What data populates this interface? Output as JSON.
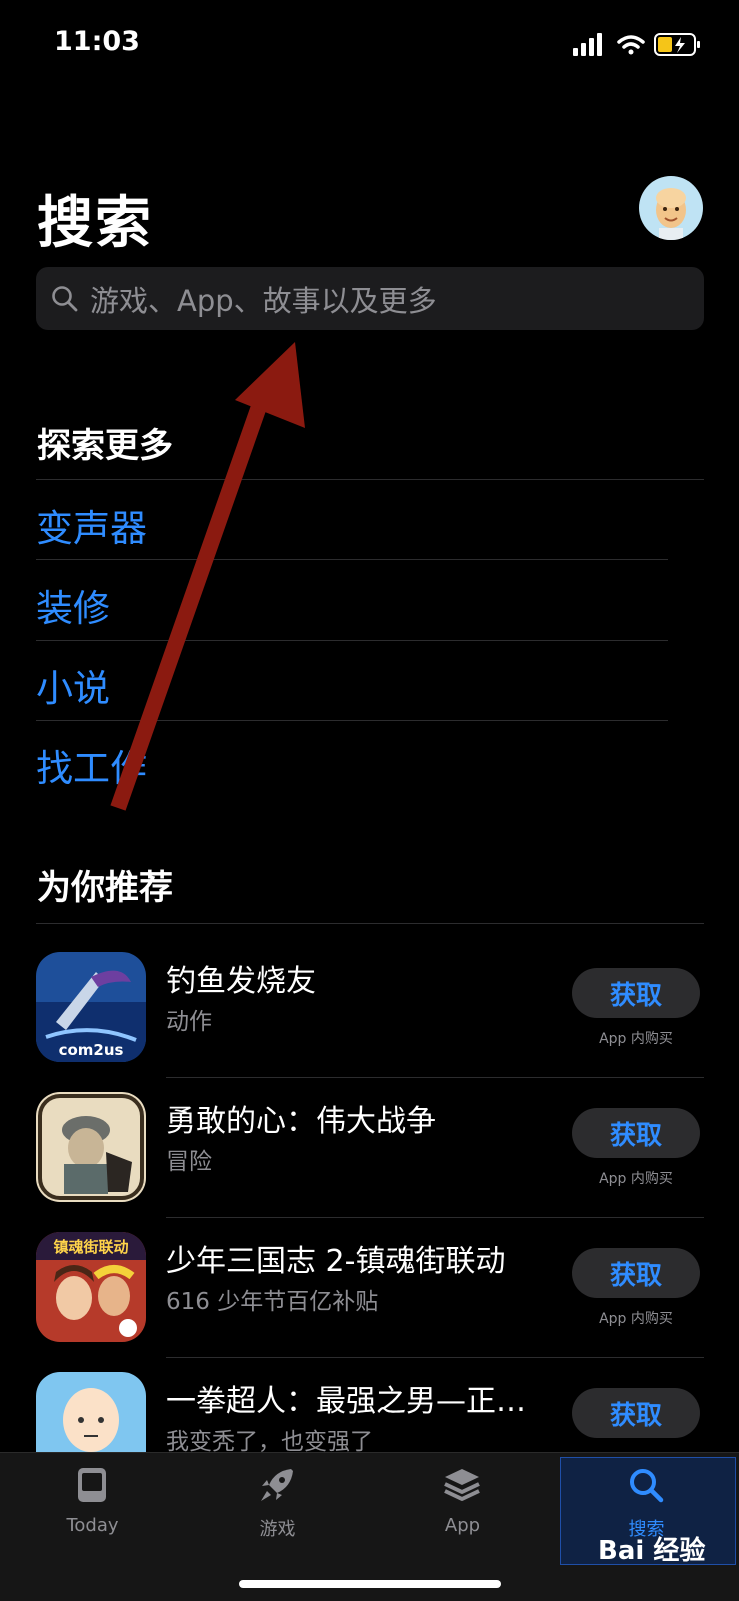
{
  "status_bar": {
    "time": "11:03"
  },
  "header": {
    "title": "搜索"
  },
  "search": {
    "placeholder": "游戏、App、故事以及更多"
  },
  "explore": {
    "title": "探索更多",
    "items": [
      "变声器",
      "装修",
      "小说",
      "找工作"
    ]
  },
  "recommend": {
    "title": "为你推荐",
    "apps": [
      {
        "name": "钓鱼发烧友",
        "subtitle": "动作",
        "button": "获取",
        "note": "App 内购买",
        "icon": "fishing-game-icon",
        "icon_text": "com2us"
      },
      {
        "name": "勇敢的心：伟大战争",
        "subtitle": "冒险",
        "button": "获取",
        "note": "App 内购买",
        "icon": "valiant-hearts-icon"
      },
      {
        "name": "少年三国志 2-镇魂街联动",
        "subtitle": "616 少年节百亿补贴",
        "button": "获取",
        "note": "App 内购买",
        "icon": "three-kingdoms-icon",
        "icon_text": "镇魂街联动"
      },
      {
        "name": "一拳超人：最强之男—正…",
        "subtitle": "我变秃了，也变强了",
        "button": "获取",
        "note": "",
        "icon": "one-punch-man-icon"
      }
    ]
  },
  "tabs": [
    {
      "label": "Today",
      "icon": "today-icon"
    },
    {
      "label": "游戏",
      "icon": "rocket-icon"
    },
    {
      "label": "App",
      "icon": "layers-icon"
    },
    {
      "label": "搜索",
      "icon": "search-icon",
      "active": true
    }
  ],
  "watermark": "Bai 经验",
  "colors": {
    "accent": "#2f8cff",
    "background": "#000000",
    "arrow": "#8b1a10"
  }
}
